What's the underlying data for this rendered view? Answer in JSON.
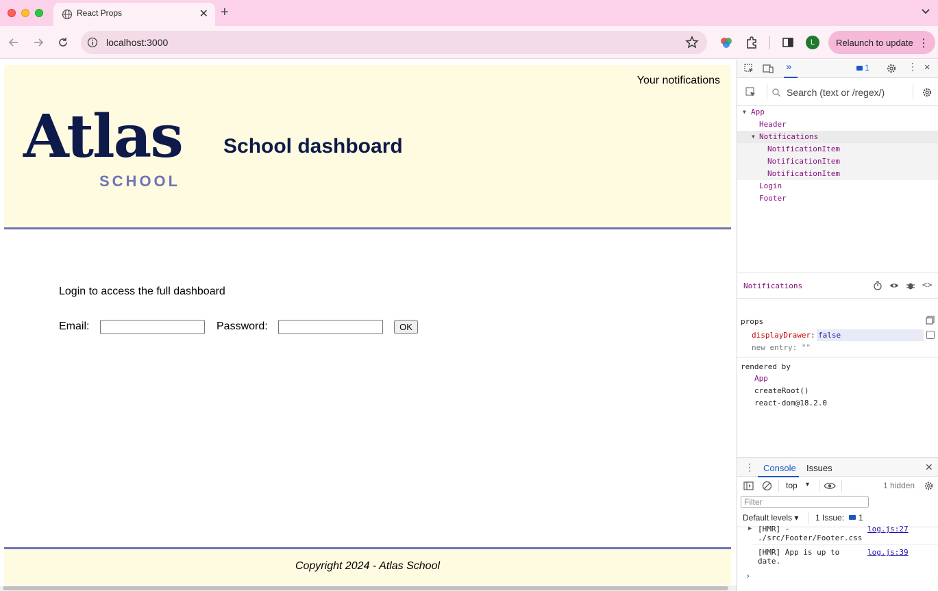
{
  "browser": {
    "tab_title": "React Props",
    "url": "localhost:3000",
    "relaunch_label": "Relaunch to update",
    "profile_initial": "L"
  },
  "page": {
    "notifications_title": "Your notifications",
    "logo_word": "Atlas",
    "logo_sub": "SCHOOL",
    "title": "School dashboard",
    "login_intro": "Login to access the full dashboard",
    "email_label": "Email:",
    "password_label": "Password:",
    "ok_label": "OK",
    "footer": "Copyright 2024 - Atlas School"
  },
  "devtools": {
    "issues_badge": "1",
    "search_placeholder": "Search (text or /regex/)",
    "tree": [
      {
        "name": "App"
      },
      {
        "name": "Header"
      },
      {
        "name": "Notifications"
      },
      {
        "name": "NotificationItem"
      },
      {
        "name": "NotificationItem"
      },
      {
        "name": "NotificationItem"
      },
      {
        "name": "Login"
      },
      {
        "name": "Footer"
      }
    ],
    "selected_component": "Notifications",
    "props_title": "props",
    "prop_key": "displayDrawer",
    "prop_value": "false",
    "new_entry": "new entry: \"\"",
    "rendered_by_title": "rendered by",
    "rendered_by": [
      "App",
      "createRoot()",
      "react-dom@18.2.0"
    ],
    "console_tab": "Console",
    "issues_tab": "Issues",
    "context": "top",
    "hidden": "1 hidden",
    "filter_placeholder": "Filter",
    "levels": "Default levels",
    "issue_summary": "1 Issue:",
    "issue_count": "1",
    "logs": [
      {
        "text1": "[HMR]  -",
        "text2": "./src/Footer/Footer.css",
        "link": "log.js:27"
      },
      {
        "text1": "[HMR] App is up to",
        "text2": "date.",
        "link": "log.js:39"
      }
    ]
  },
  "colors": {
    "header_bg": "#fffbe1",
    "accent": "#6e74b7",
    "brand_dark": "#0e1a4a"
  }
}
